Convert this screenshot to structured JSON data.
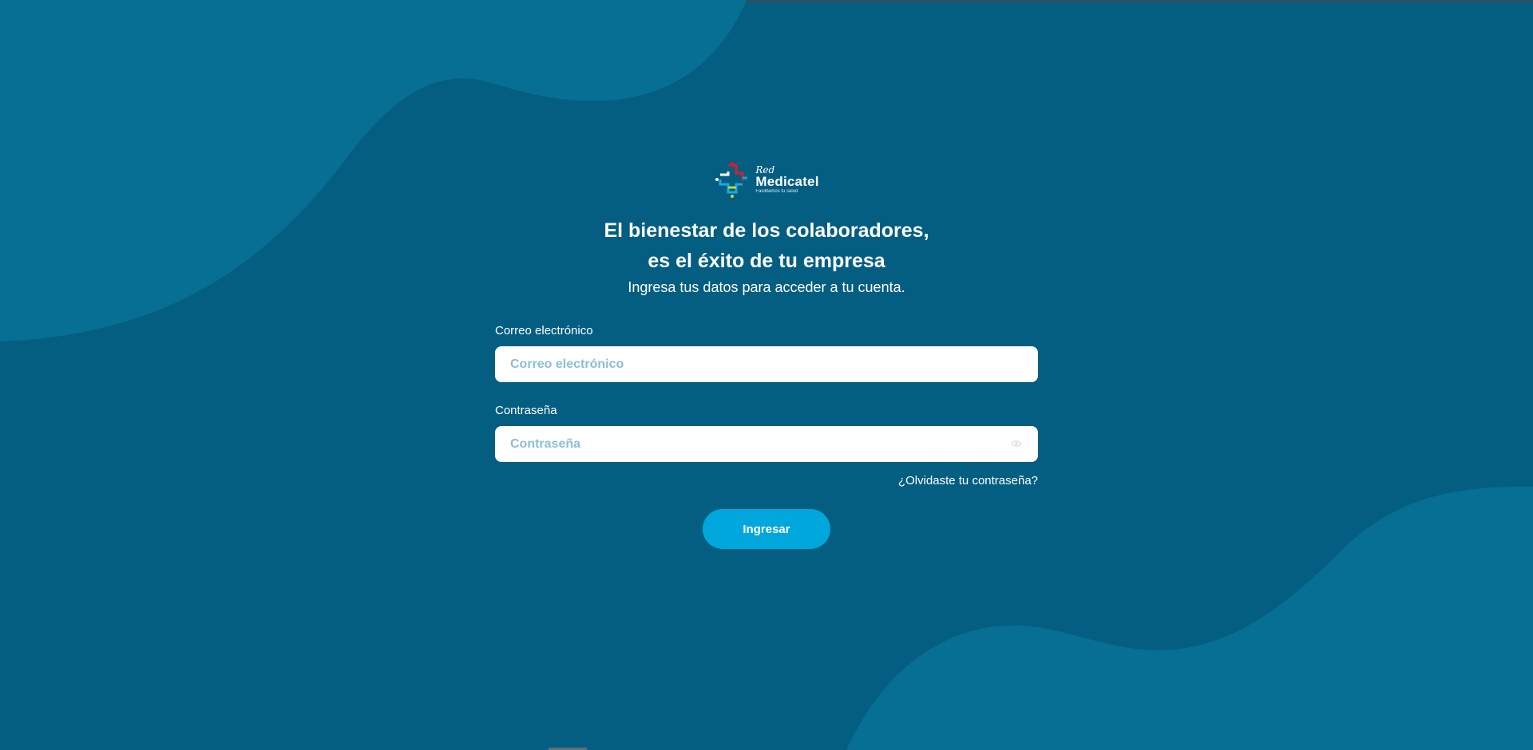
{
  "brand": {
    "line1": "Red",
    "line2": "Medicatel",
    "tagline": "Facilitamos tu salud"
  },
  "hero": {
    "headline_line1": "El bienestar de los colaboradores,",
    "headline_line2": "es el éxito de tu empresa",
    "subtitle": "Ingresa tus datos para acceder a tu cuenta."
  },
  "form": {
    "email_label": "Correo electrónico",
    "email_placeholder": "Correo electrónico",
    "email_value": "",
    "password_label": "Contraseña",
    "password_placeholder": "Contraseña",
    "password_value": "",
    "forgot_label": "¿Olvidaste tu contraseña?",
    "submit_label": "Ingresar"
  },
  "colors": {
    "background": "#035e82",
    "background_blob": "#076f94",
    "button": "#00a7dd",
    "placeholder": "#8cbfd1",
    "logo_red": "#d0202e",
    "logo_blue": "#1aa7e0",
    "logo_yellow": "#c9d62a"
  },
  "icons": {
    "password_toggle": "eye-icon",
    "logo": "medical-cross-logo-icon"
  }
}
